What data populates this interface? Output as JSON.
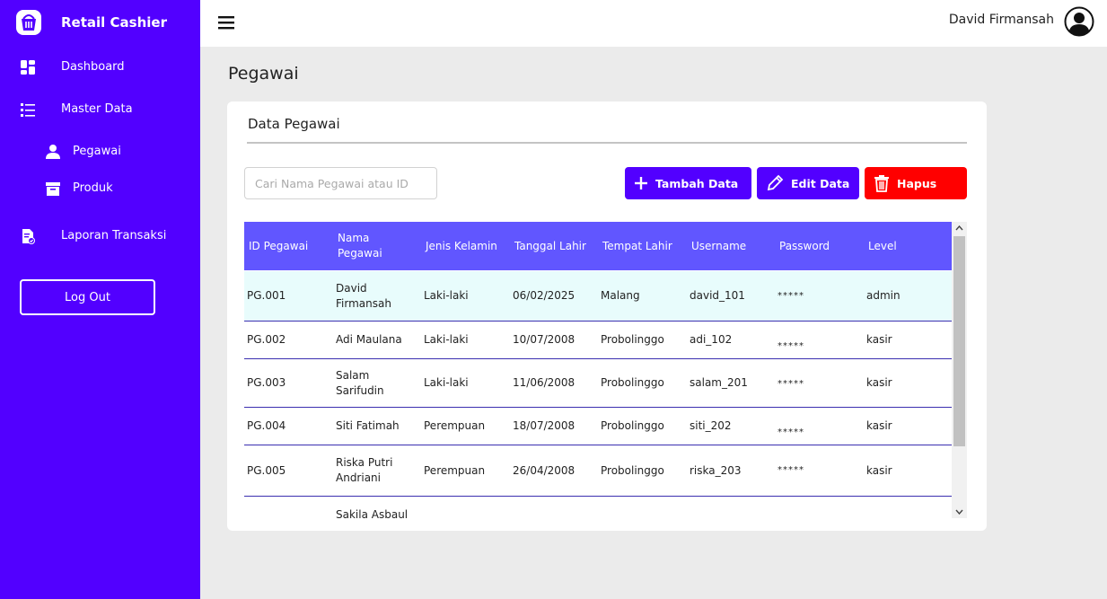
{
  "sidebar": {
    "brand": "Retail Cashier",
    "items": [
      {
        "label": "Dashboard"
      },
      {
        "label": "Master Data"
      },
      {
        "label": "Pegawai"
      },
      {
        "label": "Produk"
      },
      {
        "label": "Laporan Transaksi"
      }
    ],
    "logout_label": "Log Out",
    "color": "#5200ff"
  },
  "topbar": {
    "user_name": "David Firmansah"
  },
  "page": {
    "title": "Pegawai",
    "card_title": "Data Pegawai",
    "search_placeholder": "Cari Nama Pegawai atau ID",
    "buttons": {
      "add": "Tambah Data",
      "edit": "Edit Data",
      "delete": "Hapus"
    },
    "colors": {
      "primary": "#5200ff",
      "danger": "#ff0000",
      "table_header": "#6156ff"
    }
  },
  "table": {
    "headers": [
      "ID Pegawai",
      "Nama Pegawai",
      "Jenis Kelamin",
      "Tanggal Lahir",
      "Tempat Lahir",
      "Username",
      "Password",
      "Level"
    ],
    "rows": [
      [
        "PG.001",
        "David Firmansah",
        "Laki-laki",
        "06/02/2025",
        "Malang",
        "david_101",
        "*****",
        "admin"
      ],
      [
        "PG.002",
        "Adi Maulana",
        "Laki-laki",
        "10/07/2008",
        "Probolinggo",
        "adi_102",
        "*****",
        "kasir"
      ],
      [
        "PG.003",
        "Salam Sarifudin",
        "Laki-laki",
        "11/06/2008",
        "Probolinggo",
        "salam_201",
        "*****",
        "kasir"
      ],
      [
        "PG.004",
        "Siti Fatimah",
        "Perempuan",
        "18/07/2008",
        "Probolinggo",
        "siti_202",
        "*****",
        "kasir"
      ],
      [
        "PG.005",
        "Riska Putri Andriani",
        "Perempuan",
        "26/04/2008",
        "Probolinggo",
        "riska_203",
        "*****",
        "kasir"
      ],
      [
        "",
        "Sakila Asbaul",
        "",
        "",
        "",
        "",
        "",
        ""
      ]
    ]
  }
}
